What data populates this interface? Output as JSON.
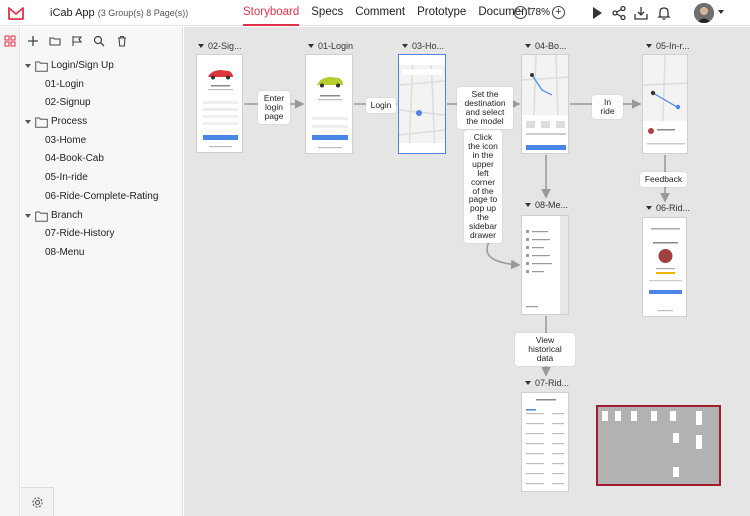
{
  "app": {
    "title": "iCab App",
    "subtitle": "(3 Group(s) 8 Page(s))"
  },
  "nav": {
    "tabs": [
      {
        "label": "Storyboard",
        "active": true
      },
      {
        "label": "Specs",
        "active": false
      },
      {
        "label": "Comment",
        "active": false
      },
      {
        "label": "Prototype",
        "active": false
      },
      {
        "label": "Document",
        "active": false
      }
    ],
    "zoom": "78%"
  },
  "colors": {
    "accent": "#e0324a",
    "selection": "#4a86e8",
    "canvas": "#e5e5e5",
    "minimap_border": "#a01d2e"
  },
  "toolbar_icons": [
    "play-icon",
    "share-icon",
    "download-icon",
    "bell-icon"
  ],
  "sidebar": {
    "tools": [
      "plus-icon",
      "folder-icon",
      "flag-icon",
      "search-icon",
      "trash-icon"
    ],
    "tree": [
      {
        "type": "group",
        "label": "Login/Sign Up"
      },
      {
        "type": "page",
        "label": "01-Login"
      },
      {
        "type": "page",
        "label": "02-Signup"
      },
      {
        "type": "group",
        "label": "Process"
      },
      {
        "type": "page",
        "label": "03-Home"
      },
      {
        "type": "page",
        "label": "04-Book-Cab"
      },
      {
        "type": "page",
        "label": "05-In-ride"
      },
      {
        "type": "page",
        "label": "06-Ride-Complete-Rating"
      },
      {
        "type": "group",
        "label": "Branch"
      },
      {
        "type": "page",
        "label": "07-Ride-History"
      },
      {
        "type": "page",
        "label": "08-Menu"
      }
    ]
  },
  "canvas": {
    "frames": [
      {
        "title": "02-Sig..."
      },
      {
        "title": "01-Login"
      },
      {
        "title": "03-Ho..."
      },
      {
        "title": "04-Bo..."
      },
      {
        "title": "05-In-r..."
      },
      {
        "title": "08-Me..."
      },
      {
        "title": "06-Rid..."
      },
      {
        "title": "07-Rid..."
      }
    ],
    "notes": {
      "enter_login": "Enter login page",
      "login": "Login",
      "set_destination": "Set the destination and select the model",
      "in_ride": "In ride",
      "click_icon": "Click the icon in the upper left corner of the page to pop up the sidebar drawer",
      "feedback": "Feedback",
      "view_history": "View historical data"
    }
  }
}
